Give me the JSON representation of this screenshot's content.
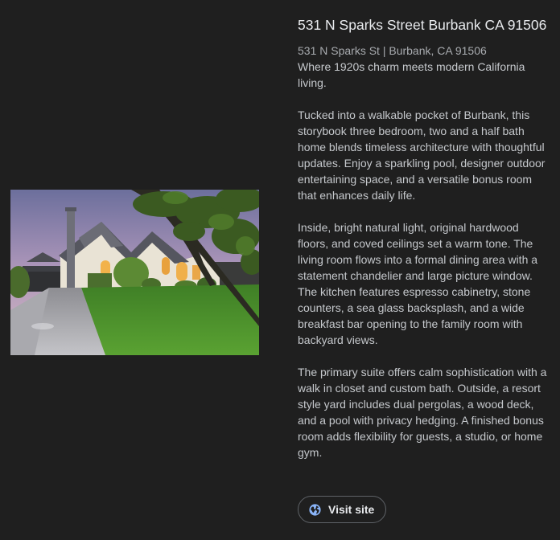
{
  "listing": {
    "title": "531 N Sparks Street Burbank CA 91506",
    "address_line": "531 N Sparks St | Burbank, CA 91506",
    "tagline": "Where 1920s charm meets modern California living.",
    "paragraphs": [
      "Tucked into a walkable pocket of Burbank, this storybook three bedroom, two and a half bath home blends timeless architecture with thoughtful updates. Enjoy a sparkling pool, designer outdoor entertaining space, and a versatile bonus room that enhances daily life.",
      "Inside, bright natural light, original hardwood floors, and coved ceilings set a warm tone. The living room flows into a formal dining area with a statement chandelier and large picture window. The kitchen features espresso cabinetry, stone counters, a sea glass backsplash, and a wide breakfast bar opening to the family room with backyard views.",
      "The primary suite offers calm sophistication with a walk in closet and custom bath. Outside, a resort style yard includes dual pergolas, a wood deck, and a pool with privacy hedging. A finished bonus room adds flexibility for guests, a studio, or home gym."
    ],
    "visit_button_label": "Visit site",
    "visit_icon": "globe-icon"
  },
  "colors": {
    "background": "#1f1f1f",
    "title": "#e8eaed",
    "body_text": "#c5c8cc",
    "button_border": "#5f6368",
    "globe_blue": "#8ab4f8"
  }
}
